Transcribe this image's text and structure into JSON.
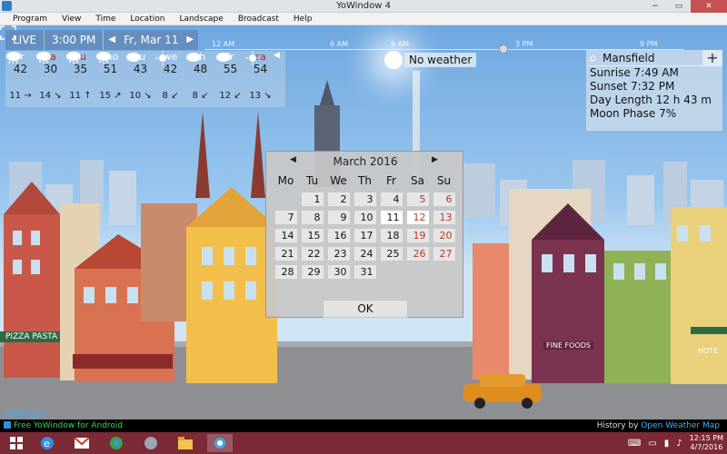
{
  "window": {
    "title": "YoWindow 4",
    "minimize": "−",
    "maximize": "▭",
    "close": "✕"
  },
  "menu": [
    "Program",
    "View",
    "Time",
    "Location",
    "Landscape",
    "Broadcast",
    "Help"
  ],
  "topbar": {
    "live": "LIVE",
    "time": "3:00 PM",
    "prev": "◀",
    "date": "Fr, Mar 11",
    "next": "▶"
  },
  "timeline": [
    "12 AM",
    "6 AM",
    "9 AM",
    "3 PM",
    "9 PM"
  ],
  "forecast": [
    {
      "day": "fr",
      "temp": "42",
      "icon": "rain",
      "wind": "11 →",
      "weekend": false
    },
    {
      "day": "sa",
      "temp": "30",
      "icon": "snow",
      "wind": "14 ↘",
      "weekend": true
    },
    {
      "day": "su",
      "temp": "35",
      "icon": "snow",
      "wind": "11 ↑",
      "weekend": true
    },
    {
      "day": "mo",
      "temp": "51",
      "icon": "snow",
      "wind": "15 ↗",
      "weekend": false
    },
    {
      "day": "tu",
      "temp": "43",
      "icon": "cloud",
      "wind": "10 ↘",
      "weekend": false
    },
    {
      "day": "we",
      "temp": "42",
      "icon": "sun",
      "wind": "8 ↙",
      "weekend": false
    },
    {
      "day": "th",
      "temp": "48",
      "icon": "cloud",
      "wind": "8 ↙",
      "weekend": false
    },
    {
      "day": "fr",
      "temp": "55",
      "icon": "cloud",
      "wind": "12 ↙",
      "weekend": false
    },
    {
      "day": "sa",
      "temp": "54",
      "icon": "sun",
      "wind": "13 ↘",
      "weekend": true
    }
  ],
  "forecast_more": "◀",
  "weather_status": "No weather",
  "location": {
    "name": "Mansfield",
    "dropdown": "▼",
    "add": "+",
    "sunrise": "Sunrise  7:49 AM",
    "sunset": "Sunset  7:32 PM",
    "day_length": "Day Length  12 h 43 m",
    "moon_phase": "Moon Phase  7%"
  },
  "calendar": {
    "month": "March 2016",
    "prev": "◀",
    "next": "▶",
    "dow": [
      "Mo",
      "Tu",
      "We",
      "Th",
      "Fr",
      "Sa",
      "Su"
    ],
    "weeks": [
      [
        "",
        "1",
        "2",
        "3",
        "4",
        "5",
        "6"
      ],
      [
        "7",
        "8",
        "9",
        "10",
        "11",
        "12",
        "13"
      ],
      [
        "14",
        "15",
        "16",
        "17",
        "18",
        "19",
        "20"
      ],
      [
        "21",
        "22",
        "23",
        "24",
        "25",
        "26",
        "27"
      ],
      [
        "28",
        "29",
        "30",
        "31",
        "",
        "",
        ""
      ]
    ],
    "selected": [
      "11",
      "12"
    ],
    "ok": "OK"
  },
  "scene_signs": {
    "pizza": "PIZZA  PASTA",
    "foods": "FINE FOODS",
    "hotel": "HOTE"
  },
  "brand": "YoWindow",
  "status": {
    "promo": "Free YoWindow for Android",
    "history": "History by ",
    "source": "Open Weather Map"
  },
  "tray": {
    "time": "12:15 PM",
    "date": "4/7/2016"
  },
  "colors": {
    "weekend": "#b23c2a",
    "taskbar": "#7c2a36",
    "promo": "#35d35a",
    "link": "#3fb0ff"
  }
}
